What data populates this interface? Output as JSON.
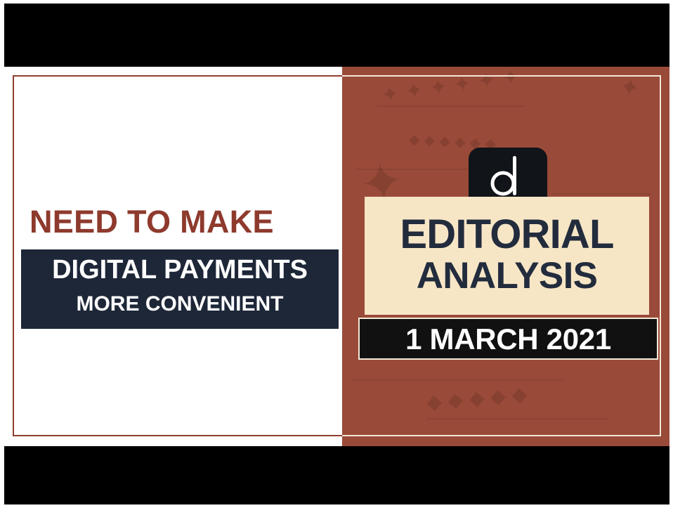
{
  "thumbnail": {
    "left_headline": "NEED TO MAKE",
    "left_banner_line1": "DIGITAL PAYMENTS",
    "left_banner_line2": "MORE CONVENIENT",
    "brand_logo_letter": "d",
    "editorial_line1": "EDITORIAL",
    "editorial_line2": "ANALYSIS",
    "date_label": "1 MARCH 2021"
  }
}
